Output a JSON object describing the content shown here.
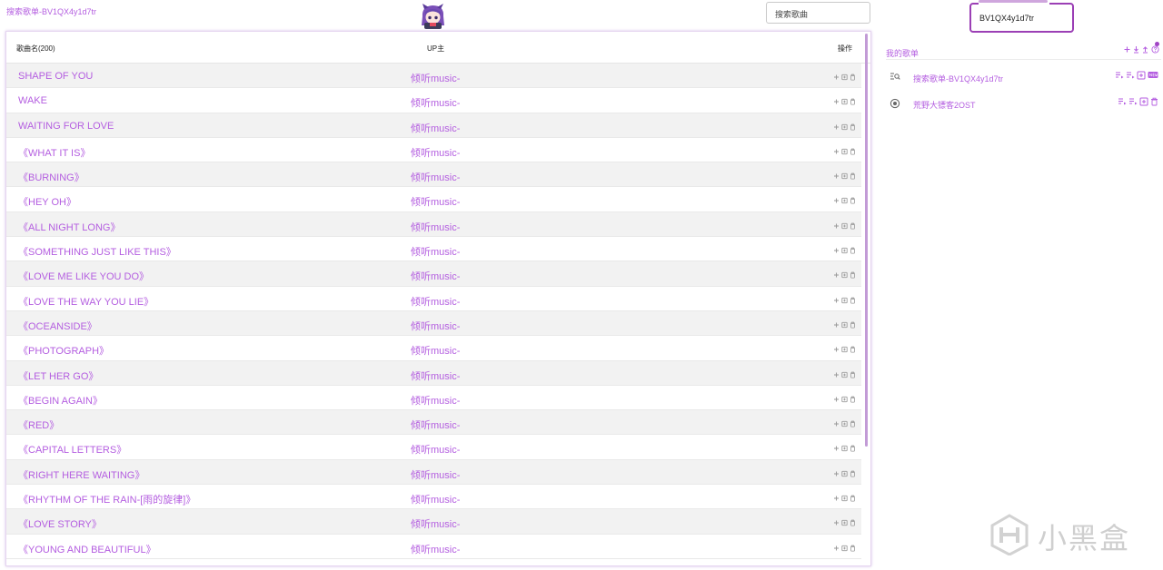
{
  "header": {
    "title": "搜索歌单-BV1QX4y1d7tr",
    "search_placeholder": "搜索歌曲",
    "bv_input_value": "BV1QX4y1d7tr"
  },
  "table": {
    "col_name": "歌曲名(200)",
    "col_up": "UP主",
    "col_ops": "操作",
    "rows": [
      {
        "name": "SHAPE OF YOU",
        "up": "倾听music-"
      },
      {
        "name": "WAKE",
        "up": "倾听music-"
      },
      {
        "name": "WAITING FOR LOVE",
        "up": "倾听music-"
      },
      {
        "name": "《WHAT IT IS》",
        "up": "倾听music-"
      },
      {
        "name": "《BURNING》",
        "up": "倾听music-"
      },
      {
        "name": "《HEY OH》",
        "up": "倾听music-"
      },
      {
        "name": "《ALL NIGHT LONG》",
        "up": "倾听music-"
      },
      {
        "name": "《SOMETHING JUST LIKE THIS》",
        "up": "倾听music-"
      },
      {
        "name": "《LOVE ME LIKE YOU DO》",
        "up": "倾听music-"
      },
      {
        "name": "《LOVE THE WAY YOU LIE》",
        "up": "倾听music-"
      },
      {
        "name": "《OCEANSIDE》",
        "up": "倾听music-"
      },
      {
        "name": "《PHOTOGRAPH》",
        "up": "倾听music-"
      },
      {
        "name": "《LET HER GO》",
        "up": "倾听music-"
      },
      {
        "name": "《BEGIN AGAIN》",
        "up": "倾听music-"
      },
      {
        "name": "《RED》",
        "up": "倾听music-"
      },
      {
        "name": "《CAPITAL LETTERS》",
        "up": "倾听music-"
      },
      {
        "name": "《RIGHT HERE WAITING》",
        "up": "倾听music-"
      },
      {
        "name": "《RHYTHM OF THE RAIN-[雨的旋律]》",
        "up": "倾听music-"
      },
      {
        "name": "《LOVE STORY》",
        "up": "倾听music-"
      },
      {
        "name": "《YOUNG AND BEAUTIFUL》",
        "up": "倾听music-"
      }
    ]
  },
  "playlist_panel": {
    "title": "我的歌单",
    "items": [
      {
        "label": "搜索歌单-BV1QX4y1d7tr",
        "icon": "search-list-icon"
      },
      {
        "label": "荒野大镖客2OST",
        "icon": "disc-icon"
      }
    ]
  },
  "watermark": {
    "text": "小黑盒"
  },
  "colors": {
    "accent": "#b45ee0",
    "accent_dark": "#9b3fb5",
    "row_alt": "#f2f2f2"
  }
}
